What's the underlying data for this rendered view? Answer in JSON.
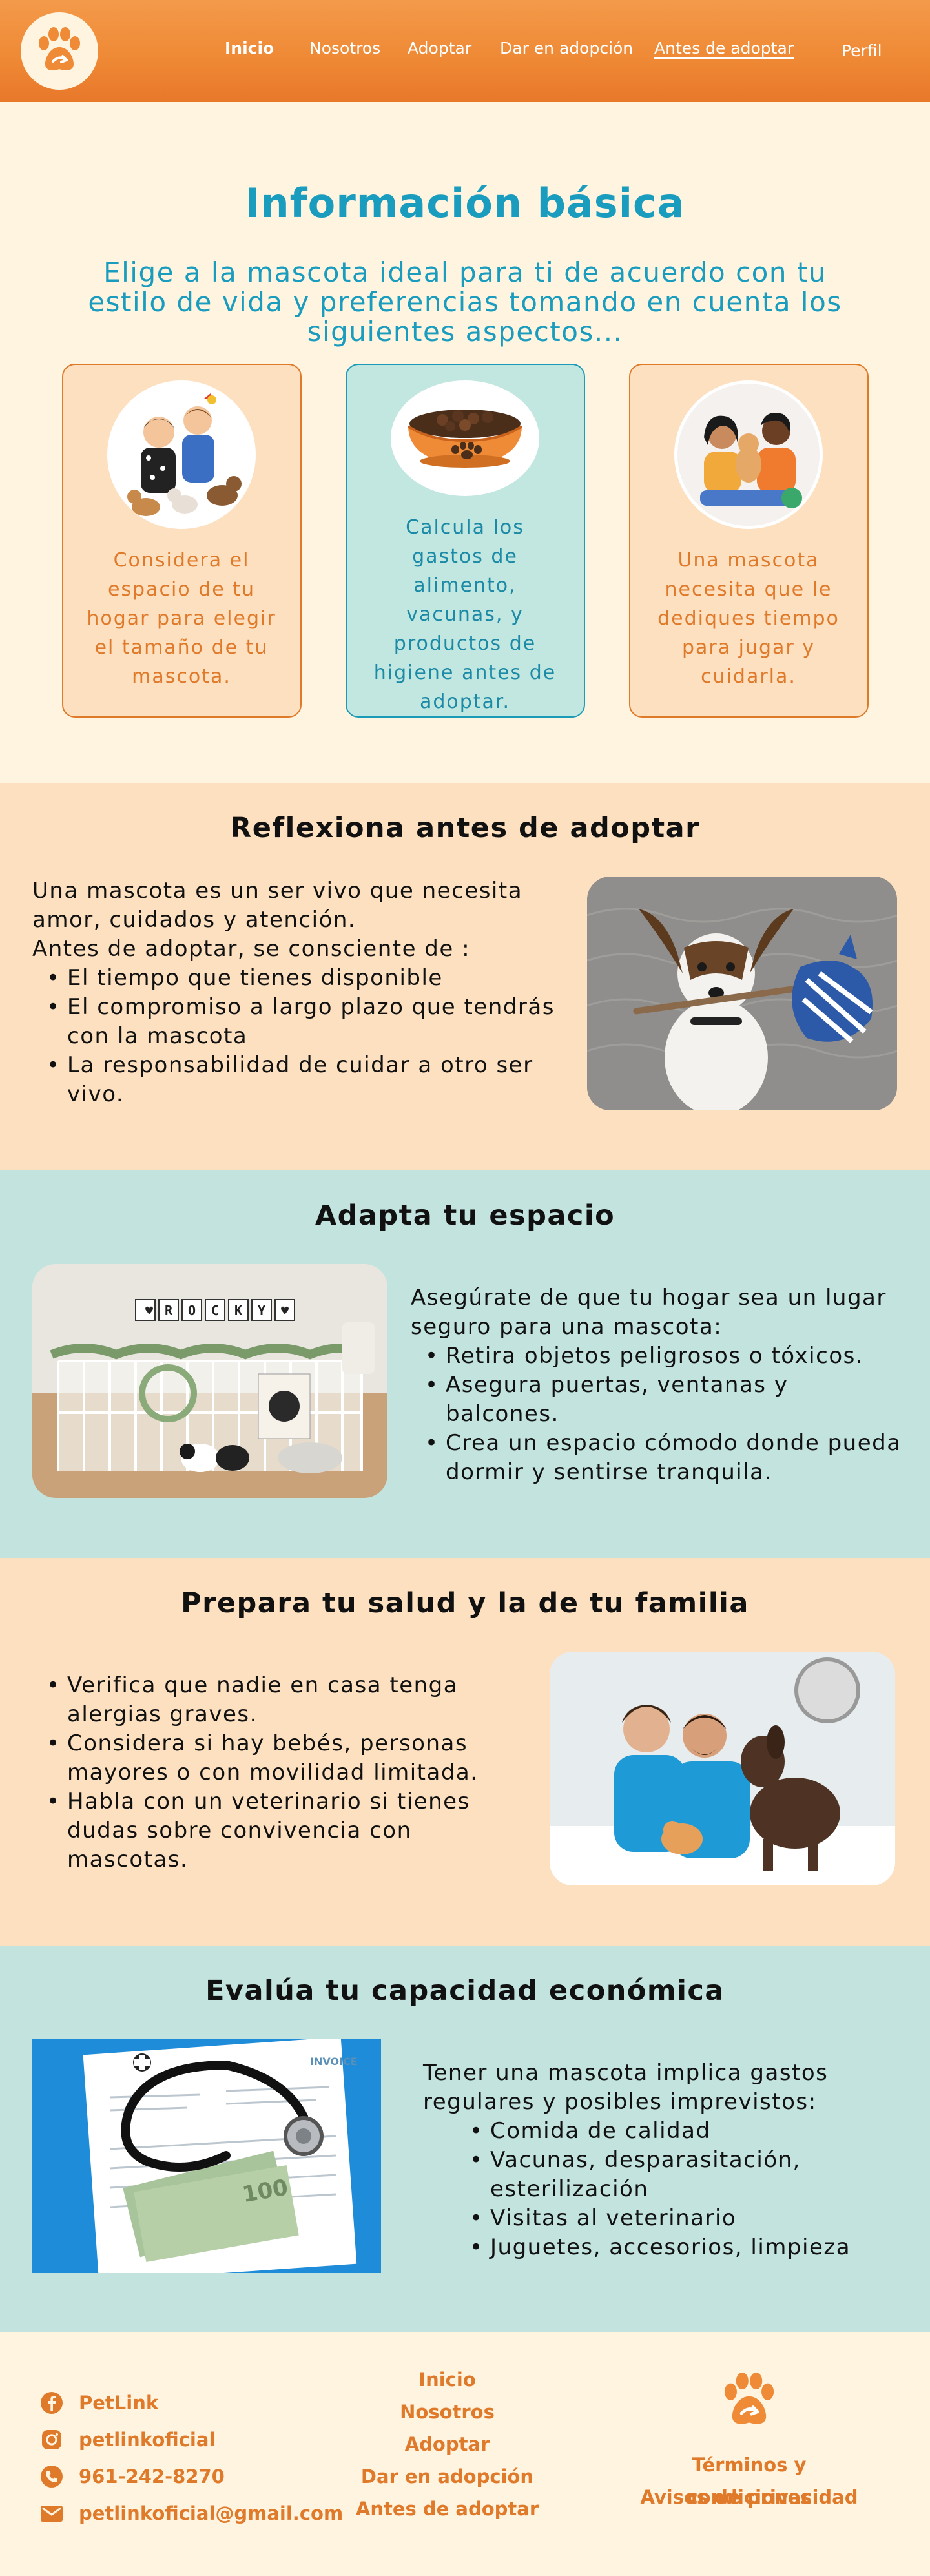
{
  "nav": {
    "home": "Inicio",
    "about": "Nosotros",
    "adopt": "Adoptar",
    "give": "Dar en adopción",
    "before": "Antes de adoptar",
    "profile": "Perfil"
  },
  "info": {
    "title": "Información básica",
    "subtitle": "Elige a la mascota ideal para ti de acuerdo con tu estilo de vida y preferencias tomando en cuenta los siguientes aspectos...",
    "cards": [
      {
        "text": "Considera el espacio de tu hogar para elegir el tamaño de tu mascota."
      },
      {
        "text": "Calcula los gastos de alimento, vacunas, y productos de higiene antes de adoptar."
      },
      {
        "text": "Una mascota necesita que le dediques tiempo para jugar y cuidarla."
      }
    ]
  },
  "reflect": {
    "title": "Reflexiona antes de adoptar",
    "p1": "Una mascota es un ser vivo que necesita amor, cuidados y atención.",
    "p2": "Antes de adoptar, se consciente de :",
    "items": [
      "El tiempo que tienes disponible",
      "El compromiso a largo plazo que tendrás con la mascota",
      "La responsabilidad de cuidar a otro ser vivo."
    ]
  },
  "space": {
    "title": "Adapta tu espacio",
    "p1": "Asegúrate de que tu hogar sea un lugar seguro para una mascota:",
    "items": [
      "Retira objetos peligrosos o tóxicos.",
      "Asegura puertas, ventanas y balcones.",
      "Crea un espacio cómodo donde pueda dormir y sentirse tranquila."
    ],
    "sign": "ROCKY"
  },
  "health": {
    "title": "Prepara tu salud y la de tu familia",
    "items": [
      "Verifica que nadie en casa tenga alergias graves.",
      "Considera si hay bebés, personas mayores o con movilidad limitada.",
      "Habla con un veterinario si tienes dudas sobre convivencia con mascotas."
    ]
  },
  "money": {
    "title": "Evalúa tu capacidad económica",
    "p1": "Tener una mascota implica gastos regulares y posibles imprevistos:",
    "items": [
      "Comida de calidad",
      "Vacunas, desparasitación, esterilización",
      "Visitas al veterinario",
      "Juguetes, accesorios, limpieza"
    ],
    "invoice": "INVOICE"
  },
  "footer": {
    "brand": "PetLink",
    "instagram": "petlinkoficial",
    "phone": "961-242-8270",
    "email": "petlinkoficial@gmail.com",
    "links": [
      "Inicio",
      "Nosotros",
      "Adoptar",
      "Dar en adopción",
      "Antes de adoptar"
    ],
    "terms": "Términos y condiciones",
    "privacy": "Avisos de privacidad"
  },
  "colors": {
    "orange": "#ef8a36",
    "teal": "#199cbd",
    "cream": "#fff4e0",
    "peach": "#fde0c0",
    "mint": "#c2e3de"
  }
}
